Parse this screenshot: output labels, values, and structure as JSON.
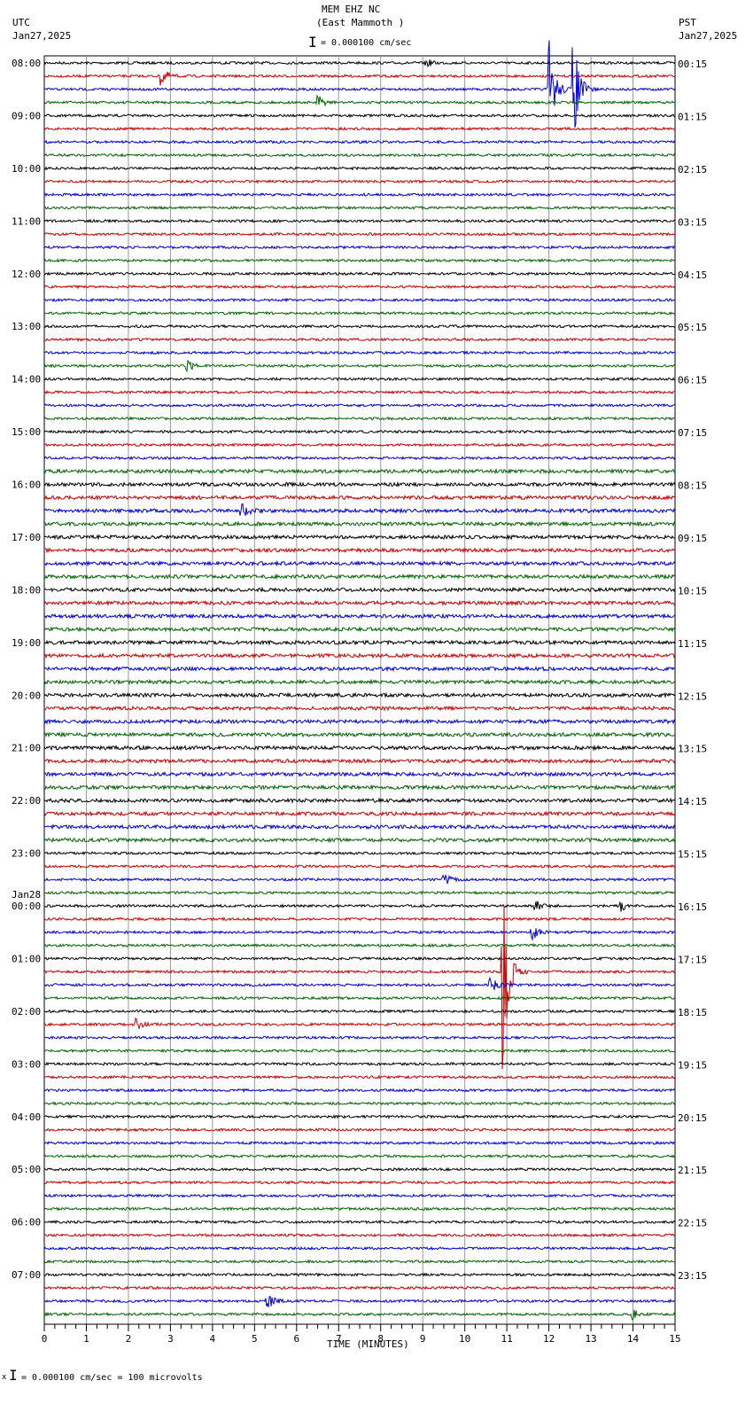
{
  "header": {
    "station": "MEM EHZ NC",
    "location": "(East Mammoth )",
    "left_tz": "UTC",
    "left_date": "Jan27,2025",
    "right_tz": "PST",
    "right_date": "Jan27,2025",
    "scale": "= 0.000100 cm/sec"
  },
  "footer": {
    "scale": "= 0.000100 cm/sec =     100 microvolts",
    "mark": "x"
  },
  "chart_data": {
    "type": "line",
    "title": "MEM EHZ NC (East Mammoth )",
    "xlabel": "TIME (MINUTES)",
    "xlim": [
      0,
      15
    ],
    "x_ticks": [
      "0",
      "1",
      "2",
      "3",
      "4",
      "5",
      "6",
      "7",
      "8",
      "9",
      "10",
      "11",
      "12",
      "13",
      "14",
      "15"
    ],
    "grid": true,
    "trace_count": 96,
    "trace_colors": [
      "#000000",
      "#cc0000",
      "#0000dd",
      "#006600"
    ],
    "utc_labels": [
      "08:00",
      "09:00",
      "10:00",
      "11:00",
      "12:00",
      "13:00",
      "14:00",
      "15:00",
      "16:00",
      "17:00",
      "18:00",
      "19:00",
      "20:00",
      "21:00",
      "22:00",
      "23:00",
      "00:00",
      "01:00",
      "02:00",
      "03:00",
      "04:00",
      "05:00",
      "06:00",
      "07:00"
    ],
    "utc_date_change": {
      "label": "Jan28",
      "at_hour_index": 16
    },
    "pst_labels": [
      "00:15",
      "01:15",
      "02:15",
      "03:15",
      "04:15",
      "05:15",
      "06:15",
      "07:15",
      "08:15",
      "09:15",
      "10:15",
      "11:15",
      "12:15",
      "13:15",
      "14:15",
      "15:15",
      "16:15",
      "17:15",
      "18:15",
      "19:15",
      "20:15",
      "21:15",
      "22:15",
      "23:15"
    ],
    "events": [
      {
        "trace": 0,
        "minute": 9.1,
        "amp": 4
      },
      {
        "trace": 1,
        "minute": 2.8,
        "amp": 10
      },
      {
        "trace": 2,
        "minute": 12.0,
        "amp": 60
      },
      {
        "trace": 2,
        "minute": 12.6,
        "amp": 55
      },
      {
        "trace": 3,
        "minute": 6.5,
        "amp": 8
      },
      {
        "trace": 23,
        "minute": 3.4,
        "amp": 7
      },
      {
        "trace": 34,
        "minute": 4.7,
        "amp": 9
      },
      {
        "trace": 62,
        "minute": 9.5,
        "amp": 7
      },
      {
        "trace": 64,
        "minute": 11.7,
        "amp": 6
      },
      {
        "trace": 64,
        "minute": 13.7,
        "amp": 6
      },
      {
        "trace": 66,
        "minute": 11.6,
        "amp": 10
      },
      {
        "trace": 69,
        "minute": 10.9,
        "amp": 120
      },
      {
        "trace": 70,
        "minute": 10.6,
        "amp": 12
      },
      {
        "trace": 73,
        "minute": 2.2,
        "amp": 7
      },
      {
        "trace": 94,
        "minute": 5.3,
        "amp": 10
      },
      {
        "trace": 95,
        "minute": 14.0,
        "amp": 5
      }
    ]
  }
}
